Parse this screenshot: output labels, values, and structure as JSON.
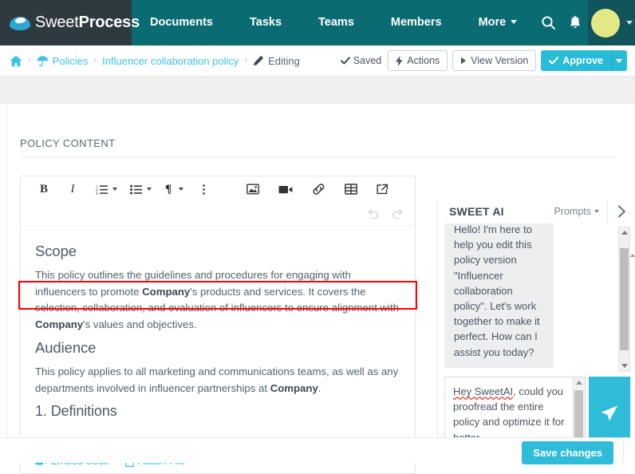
{
  "brand": {
    "name_part1": "Sweet",
    "name_part2": "Process",
    "logo_icon": "coffee-cup-icon"
  },
  "topnav": {
    "items": [
      {
        "label": "Documents",
        "icon": ""
      },
      {
        "label": "Tasks",
        "icon": ""
      },
      {
        "label": "Teams",
        "icon": ""
      },
      {
        "label": "Members",
        "icon": ""
      },
      {
        "label": "More",
        "icon": "chevron-down-icon",
        "has_caret": true
      }
    ],
    "search_icon": "search-icon",
    "bell_icon": "bell-icon",
    "avatar_icon": "avatar",
    "avatar_caret": "chevron-down-icon",
    "background_color": "#0a6b73",
    "brand_background_color": "#2f3a40",
    "avatar_color": "#e2e884"
  },
  "breadcrumb": {
    "home_icon": "home-icon",
    "separator": "›",
    "items": [
      {
        "label": "Policies",
        "icon": "umbrella-icon",
        "link": true
      },
      {
        "label": "Influencer collaboration policy",
        "icon": "",
        "link": true
      },
      {
        "label": "Editing",
        "icon": "pencil-icon",
        "link": false
      }
    ]
  },
  "header_actions": {
    "saved_label": "Saved",
    "saved_icon": "check-icon",
    "actions_label": "Actions",
    "actions_icon": "bolt-icon",
    "view_version_label": "View Version",
    "view_version_icon": "play-icon",
    "approve_label": "Approve",
    "approve_icon": "check-icon",
    "approve_caret_icon": "chevron-down-icon",
    "approve_color": "#29bcd7"
  },
  "main": {
    "section_title": "POLICY CONTENT"
  },
  "toolbar": {
    "highlighted": true,
    "highlight_color": "#fb0007",
    "buttons": [
      {
        "name": "bold",
        "glyph": "B",
        "icon": "bold-icon"
      },
      {
        "name": "italic",
        "glyph": "I",
        "icon": "italic-icon"
      },
      {
        "name": "ordered-list",
        "glyph": "",
        "icon": "ordered-list-icon",
        "caret": true
      },
      {
        "name": "unordered-list",
        "glyph": "",
        "icon": "unordered-list-icon",
        "caret": true
      },
      {
        "name": "paragraph",
        "glyph": "¶",
        "icon": "paragraph-icon",
        "caret": true
      },
      {
        "name": "more-options",
        "glyph": "⋮",
        "icon": "more-vertical-icon"
      },
      {
        "name": "insert-image",
        "glyph": "",
        "icon": "image-icon"
      },
      {
        "name": "insert-video",
        "glyph": "",
        "icon": "video-icon"
      },
      {
        "name": "insert-link",
        "glyph": "",
        "icon": "link-icon"
      },
      {
        "name": "insert-table",
        "glyph": "",
        "icon": "table-icon"
      },
      {
        "name": "open-external",
        "glyph": "",
        "icon": "external-link-icon"
      }
    ],
    "undo_icon": "undo-icon",
    "redo_icon": "redo-icon"
  },
  "document": {
    "blocks": [
      {
        "type": "h2",
        "text": "Scope"
      },
      {
        "type": "p",
        "html": "This policy outlines the guidelines and procedures for engaging with influencers to promote <b>Company</b>'s products and services. It covers the selection, collaboration, and evaluation of influencers to ensure alignment with <b>Company</b>'s values and objectives."
      },
      {
        "type": "h2",
        "text": "Audience"
      },
      {
        "type": "p",
        "html": "This policy applies to all marketing and communications teams, as well as any departments involved in influencer partnerships at <b>Company</b>."
      },
      {
        "type": "h2",
        "text": "1. Definitions"
      }
    ]
  },
  "attachments": {
    "embed_code_label": "Embed Code",
    "embed_code_icon": "video-icon",
    "attach_file_label": "Attach File",
    "attach_file_icon": "file-icon"
  },
  "ai_panel": {
    "title": "SWEET AI",
    "prompts_label": "Prompts",
    "prompts_caret_icon": "chevron-down-icon",
    "collapse_icon": "chevron-right-icon",
    "assistant_message": "Hello! I'm here to help you edit this policy version \"Influencer collaboration policy\". Let's work together to make it perfect. How can I assist you today?",
    "input_value_line1": "Hey SweetAI",
    "input_value_rest": ", could you proofread the entire policy and optimize it for better",
    "send_icon": "send-icon",
    "send_color": "#2ebcd8"
  },
  "footer": {
    "save_changes_label": "Save changes",
    "save_changes_color": "#2ebcd8"
  }
}
